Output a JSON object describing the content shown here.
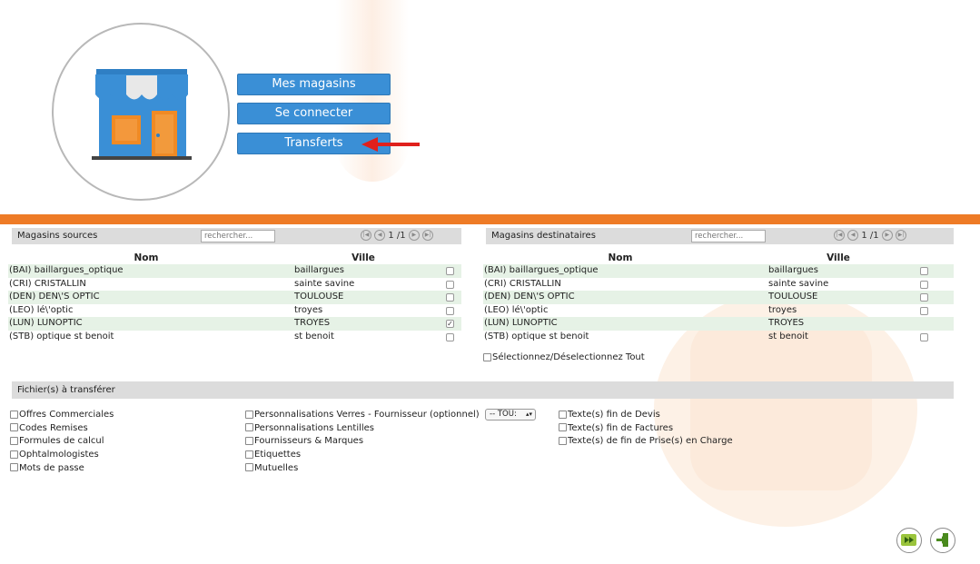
{
  "nav": {
    "mes_magasins": "Mes magasins",
    "se_connecter": "Se connecter",
    "transferts": "Transferts"
  },
  "sources": {
    "title": "Magasins sources",
    "search_placeholder": "rechercher...",
    "page": "1 /1",
    "col_nom": "Nom",
    "col_ville": "Ville",
    "rows": [
      {
        "nom": "(BAI) baillargues_optique",
        "ville": "baillargues",
        "checked": false
      },
      {
        "nom": "(CRI) CRISTALLIN",
        "ville": "sainte savine",
        "checked": false
      },
      {
        "nom": "(DEN) DEN\\'S OPTIC",
        "ville": "TOULOUSE",
        "checked": false
      },
      {
        "nom": "(LEO) lé\\'optic",
        "ville": "troyes",
        "checked": false
      },
      {
        "nom": "(LUN) LUNOPTIC",
        "ville": "TROYES",
        "checked": true
      },
      {
        "nom": "(STB) optique st benoit",
        "ville": "st benoit",
        "checked": false
      }
    ]
  },
  "destinations": {
    "title": "Magasins destinataires",
    "search_placeholder": "rechercher...",
    "page": "1 /1",
    "col_nom": "Nom",
    "col_ville": "Ville",
    "rows": [
      {
        "nom": "(BAI) baillargues_optique",
        "ville": "baillargues",
        "checkbox": true
      },
      {
        "nom": "(CRI) CRISTALLIN",
        "ville": "sainte savine",
        "checkbox": true
      },
      {
        "nom": "(DEN) DEN\\'S OPTIC",
        "ville": "TOULOUSE",
        "checkbox": true
      },
      {
        "nom": "(LEO) lé\\'optic",
        "ville": "troyes",
        "checkbox": true
      },
      {
        "nom": "(LUN) LUNOPTIC",
        "ville": "TROYES",
        "checkbox": false
      },
      {
        "nom": "(STB) optique st benoit",
        "ville": "st benoit",
        "checkbox": true
      }
    ],
    "select_all": "Sélectionnez/Déselectionnez Tout"
  },
  "files": {
    "title": "Fichier(s) à transférer",
    "col1": [
      "Offres Commerciales",
      "Codes Remises",
      "Formules de calcul",
      "Ophtalmologistes",
      "Mots de passe"
    ],
    "col2": [
      "Personnalisations Verres - Fournisseur (optionnel)",
      "Personnalisations Lentilles",
      "Fournisseurs & Marques",
      "Etiquettes",
      "Mutuelles"
    ],
    "select_value": "-- TOU:",
    "col3": [
      "Texte(s) fin de Devis",
      "Texte(s) fin de Factures",
      "Texte(s) de fin de Prise(s) en Charge"
    ]
  },
  "colors": {
    "accent_orange": "#ee7b26",
    "button_blue": "#3a8fd6",
    "row_green": "#e6f2e6",
    "arrow_red": "#e0201c"
  },
  "icons": {
    "shop": "shop-icon",
    "transfer": "transfer-icon",
    "exit": "exit-icon"
  }
}
